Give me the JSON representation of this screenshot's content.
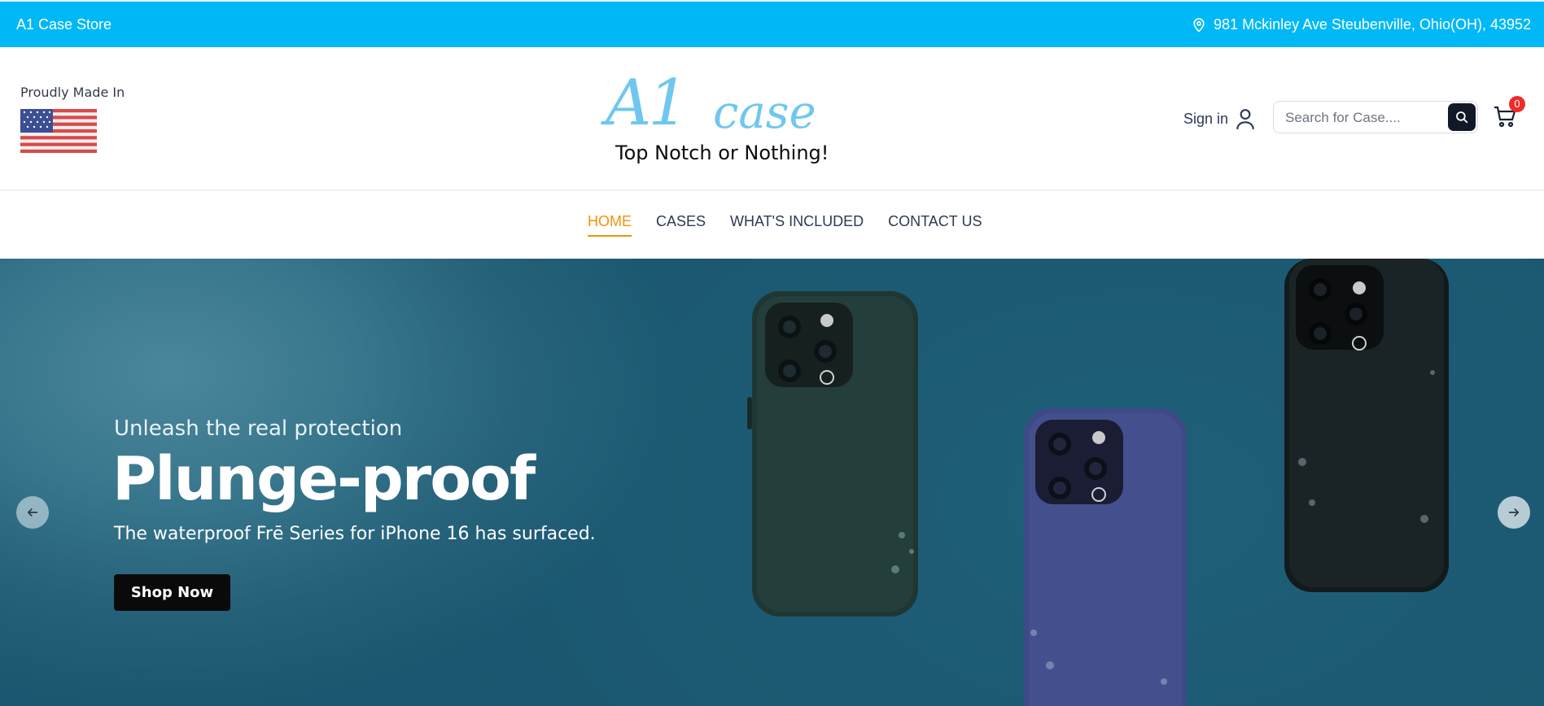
{
  "topbar": {
    "store_name": "A1 Case Store",
    "address": "981 Mckinley Ave Steubenville, Ohio(OH), 43952",
    "address_icon": "location-pin-icon",
    "bg_color": "#00b8f5"
  },
  "header": {
    "made_in_label": "Proudly Made In",
    "flag_icon": "us-flag-icon",
    "logo_a1": "A1",
    "logo_case": "case",
    "tagline": "Top Notch or Nothing!",
    "signin_label": "Sign in",
    "user_icon": "user-icon",
    "search_placeholder": "Search for Case....",
    "search_icon": "search-icon",
    "cart_icon": "cart-icon",
    "cart_count": "0",
    "logo_color": "#6fc7ef"
  },
  "nav": {
    "items": [
      {
        "label": "HOME",
        "active": true
      },
      {
        "label": "CASES",
        "active": false
      },
      {
        "label": "WHAT'S INCLUDED",
        "active": false
      },
      {
        "label": "CONTACT US",
        "active": false
      }
    ],
    "active_color": "#f29208"
  },
  "hero": {
    "eyebrow": "Unleash the real protection",
    "title": "Plunge-proof",
    "subtitle": "The waterproof Frē Series for iPhone 16 has surfaced.",
    "cta_label": "Shop Now",
    "prev_icon": "arrow-left-icon",
    "next_icon": "arrow-right-icon",
    "phone_colors": [
      "#1f3733",
      "#3e4a86",
      "#121a1c"
    ]
  }
}
